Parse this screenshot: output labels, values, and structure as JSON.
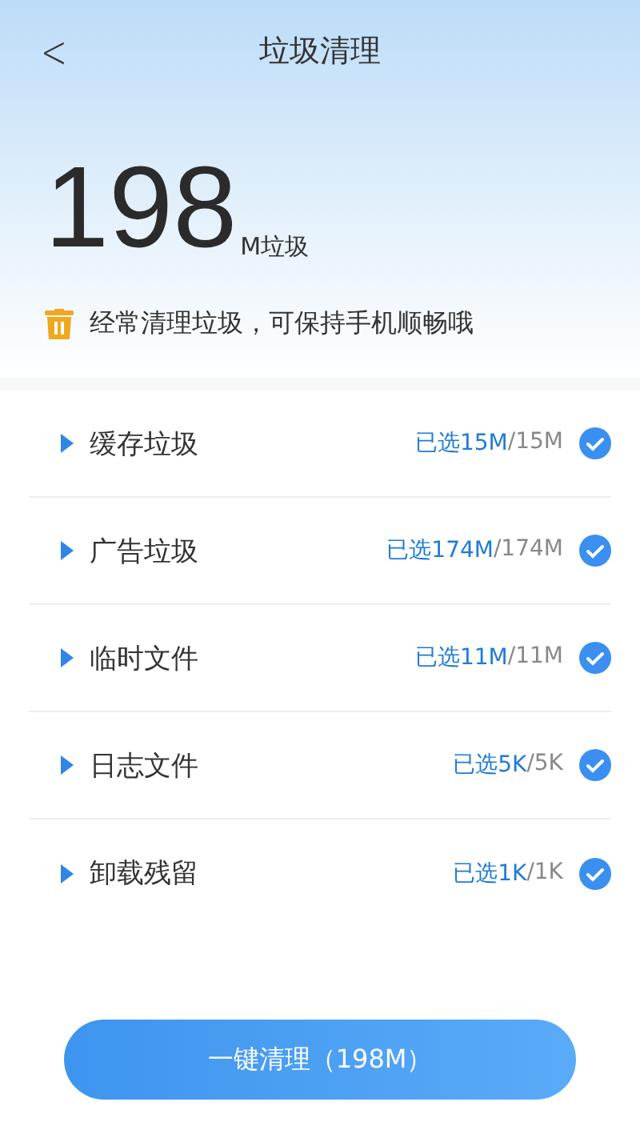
{
  "header": {
    "back": "<",
    "title": "垃圾清理"
  },
  "summary": {
    "amount": "198",
    "unit": "M垃圾",
    "tip": "经常清理垃圾，可保持手机顺畅哦"
  },
  "items": [
    {
      "name": "缓存垃圾",
      "selected_size": "已选15M",
      "total_size": "/15M",
      "checked": true
    },
    {
      "name": "广告垃圾",
      "selected_size": "已选174M",
      "total_size": "/174M",
      "checked": true
    },
    {
      "name": "临时文件",
      "selected_size": "已选11M",
      "total_size": "/11M",
      "checked": true
    },
    {
      "name": "日志文件",
      "selected_size": "已选5K",
      "total_size": "/5K",
      "checked": true
    },
    {
      "name": "卸载残留",
      "selected_size": "已选1K",
      "total_size": "/1K",
      "checked": true
    }
  ],
  "clean_button": "一键清理（198M）"
}
